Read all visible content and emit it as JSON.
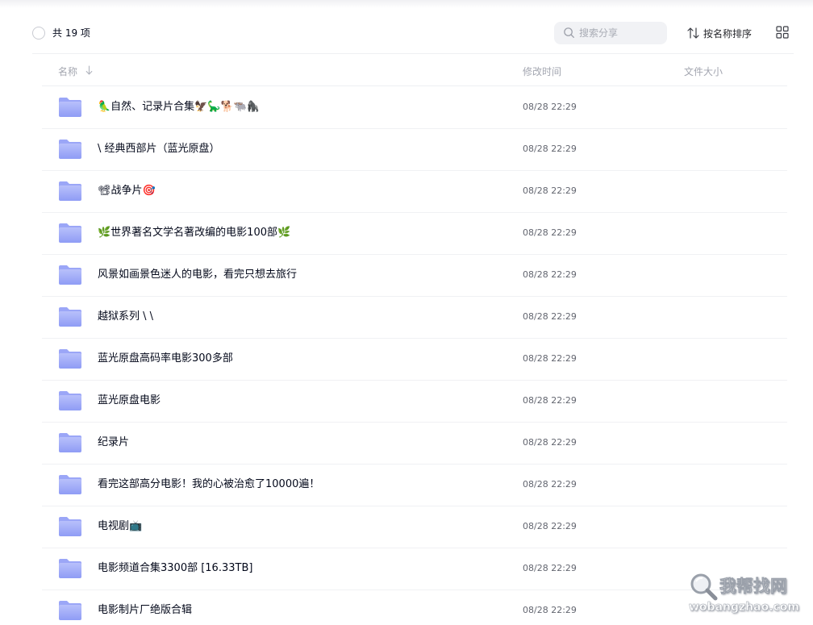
{
  "toolbar": {
    "count_label": "共 19 项",
    "search_placeholder": "搜索分享",
    "sort_label": "按名称排序"
  },
  "columns": {
    "name": "名称",
    "modified": "修改时间",
    "size": "文件大小"
  },
  "files": [
    {
      "name": "🦜自然、记录片合集🦅🦕🐕🐃🦍",
      "modified": "08/28 22:29",
      "size": ""
    },
    {
      "name": "\\ 经典西部片（蓝光原盘）",
      "modified": "08/28 22:29",
      "size": ""
    },
    {
      "name": "📽战争片🎯",
      "modified": "08/28 22:29",
      "size": ""
    },
    {
      "name": "🌿世界著名文学名著改编的电影100部🌿",
      "modified": "08/28 22:29",
      "size": ""
    },
    {
      "name": "风景如画景色迷人的电影，看完只想去旅行",
      "modified": "08/28 22:29",
      "size": ""
    },
    {
      "name": "越狱系列 \\ \\",
      "modified": "08/28 22:29",
      "size": ""
    },
    {
      "name": "蓝光原盘高码率电影300多部",
      "modified": "08/28 22:29",
      "size": ""
    },
    {
      "name": "蓝光原盘电影",
      "modified": "08/28 22:29",
      "size": ""
    },
    {
      "name": "纪录片",
      "modified": "08/28 22:29",
      "size": ""
    },
    {
      "name": "看完这部高分电影！我的心被治愈了10000遍！",
      "modified": "08/28 22:29",
      "size": ""
    },
    {
      "name": "电视剧📺",
      "modified": "08/28 22:29",
      "size": ""
    },
    {
      "name": "电影频道合集3300部 [16.33TB]",
      "modified": "08/28 22:29",
      "size": ""
    },
    {
      "name": "电影制片厂绝版合辑",
      "modified": "08/28 22:29",
      "size": ""
    }
  ],
  "watermark": {
    "title": "我帮找网",
    "url": "wobangzhao.com"
  },
  "icons": {
    "folder": "folder-icon",
    "search": "search-icon",
    "sort": "sort-icon",
    "grid": "grid-view-icon",
    "sort_direction": "arrow-down-icon"
  },
  "colors": {
    "folder_light": "#c3c8fb",
    "folder_dark": "#8e9af6",
    "muted_text": "#a3a6b0",
    "divider": "#eeeff2"
  }
}
